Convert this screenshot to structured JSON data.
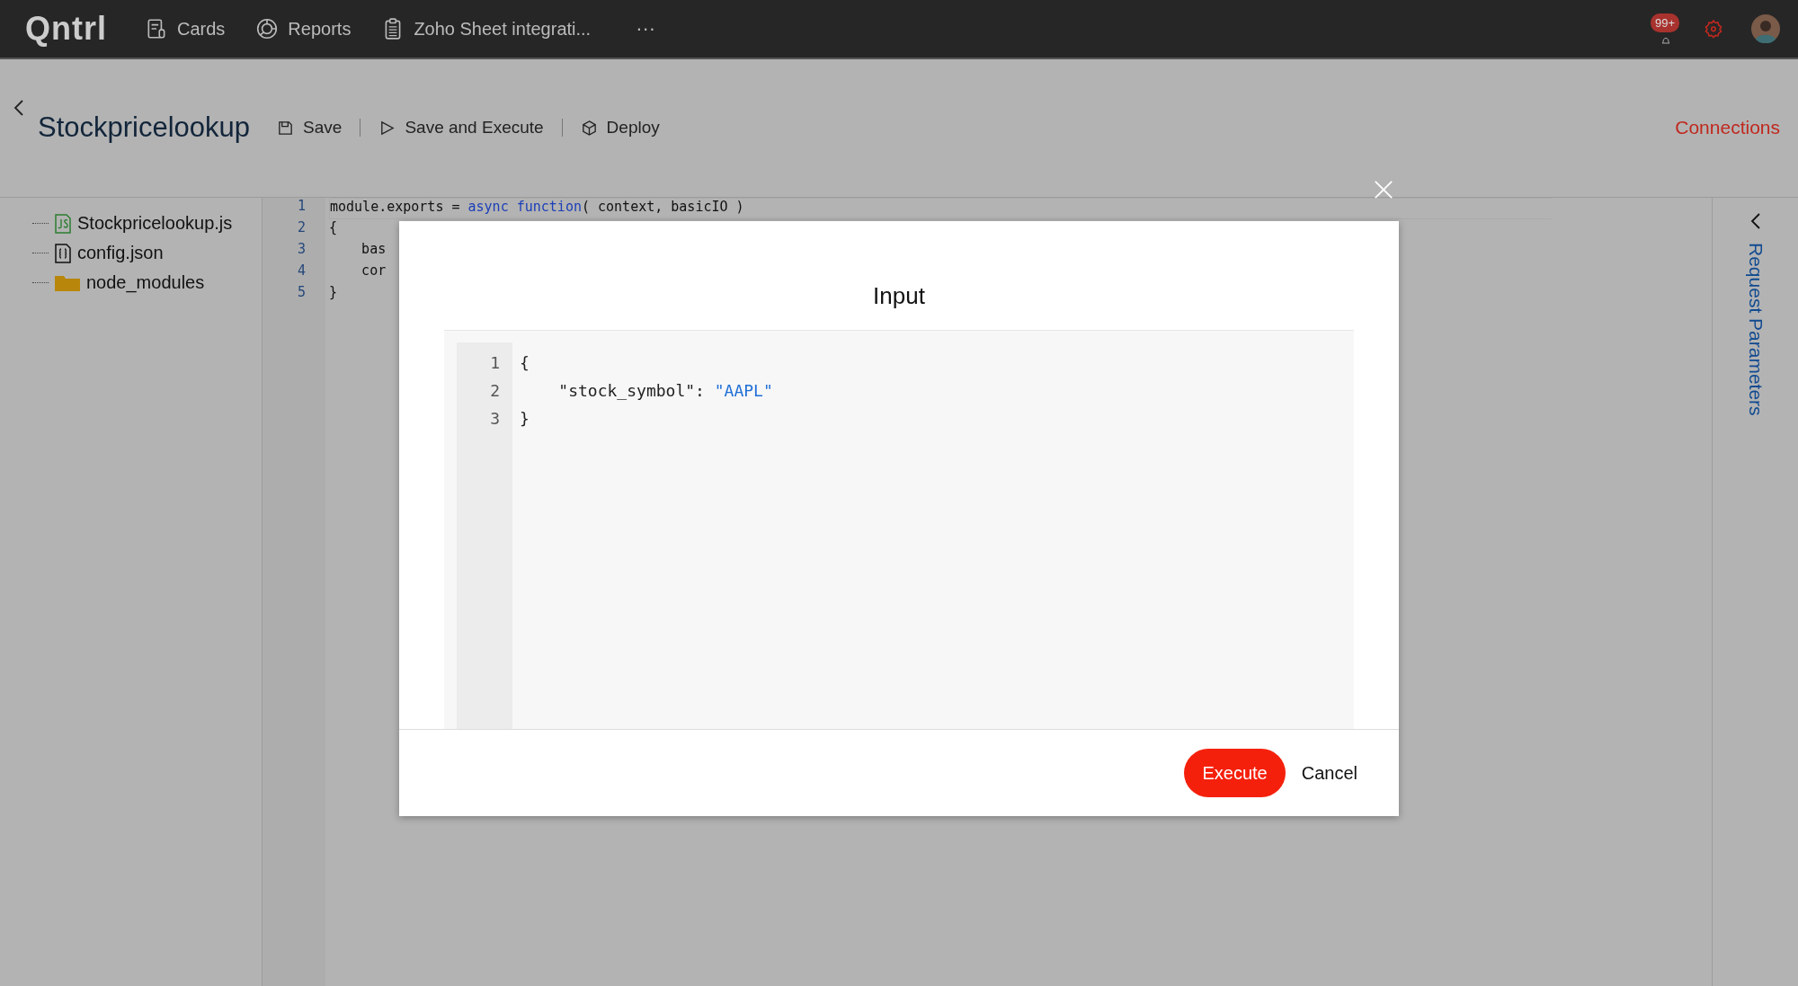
{
  "top_bar": {
    "logo": "Qntrl",
    "nav": [
      {
        "label": "Cards",
        "kind": "cards"
      },
      {
        "label": "Reports",
        "kind": "reports"
      },
      {
        "label": "Zoho Sheet integrati...",
        "kind": "sheet"
      }
    ],
    "more": "···",
    "notification_count": "99+"
  },
  "header": {
    "title": "Stockpricelookup",
    "actions": [
      {
        "label": "Save",
        "kind": "save"
      },
      {
        "label": "Save and Execute",
        "kind": "run"
      },
      {
        "label": "Deploy",
        "kind": "deploy"
      }
    ],
    "connections": "Connections"
  },
  "file_tree": [
    {
      "name": "Stockpricelookup.js",
      "kind": "js"
    },
    {
      "name": "config.json",
      "kind": "json"
    },
    {
      "name": "node_modules",
      "kind": "folder"
    }
  ],
  "editor": {
    "lines": [
      {
        "number": "1",
        "segments": [
          {
            "text": "module.exports = ",
            "kind": "plain"
          },
          {
            "text": "async function",
            "kind": "keyword"
          },
          {
            "text": "( context, basicIO )",
            "kind": "plain"
          }
        ]
      },
      {
        "number": "2",
        "segments": [
          {
            "text": "{",
            "kind": "plain"
          }
        ]
      },
      {
        "number": "3",
        "segments": [
          {
            "text": "    bas",
            "kind": "plain"
          }
        ]
      },
      {
        "number": "4",
        "segments": [
          {
            "text": "    cor",
            "kind": "plain"
          }
        ]
      },
      {
        "number": "5",
        "segments": [
          {
            "text": "}",
            "kind": "plain"
          }
        ]
      }
    ]
  },
  "right_panel": {
    "title": "Request Parameters"
  },
  "modal": {
    "title": "Input",
    "lines": [
      {
        "number": "1",
        "segments": [
          {
            "text": "{",
            "kind": "plain"
          }
        ]
      },
      {
        "number": "2",
        "segments": [
          {
            "text": "    \"stock_symbol\": ",
            "kind": "plain"
          },
          {
            "text": "\"AAPL\"",
            "kind": "string"
          }
        ]
      },
      {
        "number": "3",
        "segments": [
          {
            "text": "}",
            "kind": "plain"
          }
        ]
      }
    ],
    "buttons": [
      {
        "label": "Execute",
        "kind": "primary"
      },
      {
        "label": "Cancel",
        "kind": "secondary"
      }
    ]
  }
}
